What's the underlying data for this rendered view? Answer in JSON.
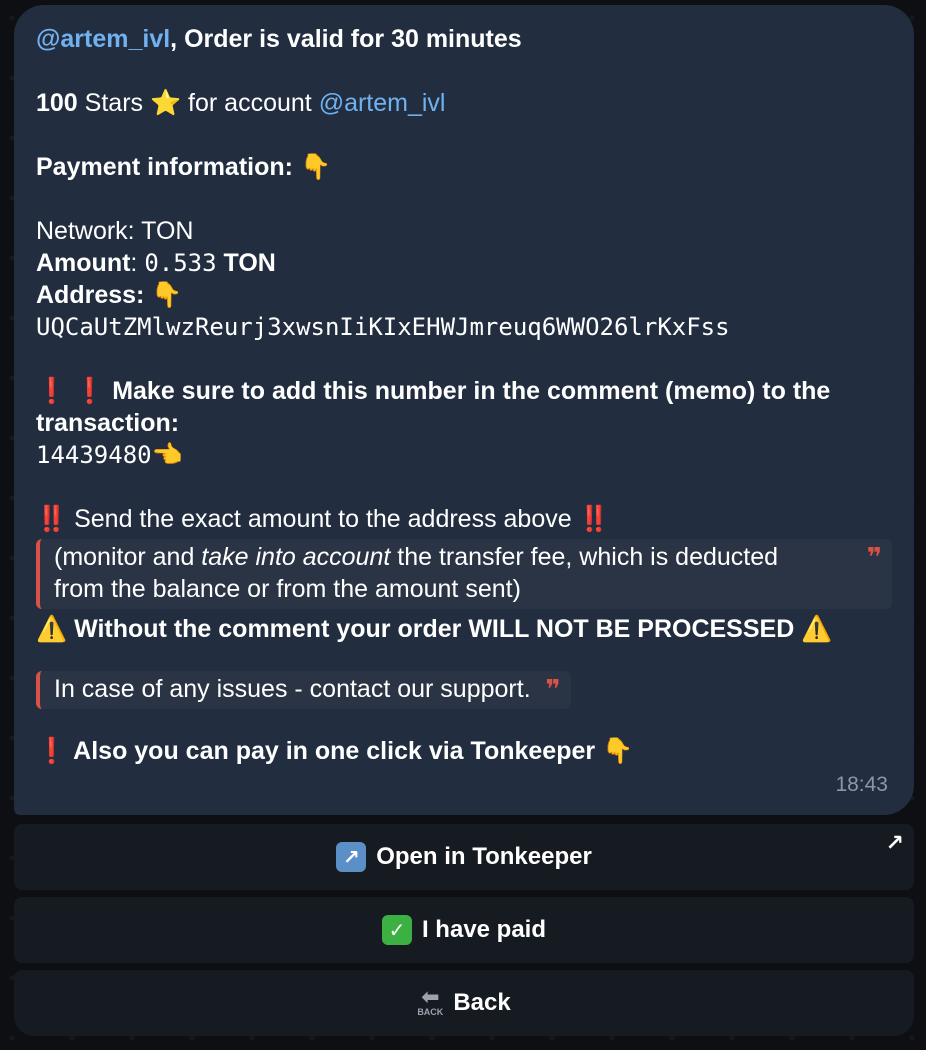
{
  "message": {
    "header_user": "@artem_ivl",
    "header_text": ", Order is valid for 30 minutes",
    "stars_amount": "100",
    "stars_word": " Stars",
    "star_emoji": "⭐",
    "for_account": " for account ",
    "account_link": "@artem_ivl",
    "payment_info_label": "Payment information",
    "payment_info_colon": ":",
    "point_down_emoji": "👇",
    "network_text": "Network: TON",
    "amount_label": "Amount",
    "amount_colon": ": ",
    "amount_value": "0.533",
    "amount_unit": " TON",
    "address_label": "Address",
    "address_colon": ":",
    "address_value": "UQCaUtZMlwzReurj3xwsnIiKIxEHWJmreuq6WWO26lrKxFss",
    "exclaim_emoji": "❗",
    "memo_warning_line1": "Make sure to add this number in the comment (memo) to the",
    "memo_warning_line2": "transaction:",
    "memo_number": "14439480",
    "point_left_emoji": "👈",
    "double_exclaim_emoji": "‼️",
    "send_exact_text": " Send the exact amount to the address above ",
    "quote1_part1": "(monitor and ",
    "quote1_italic": "take into account",
    "quote1_part2": " the transfer fee, which is deducted",
    "quote1_line2": "from the balance or from the amount sent)",
    "warning_emoji": "⚠️",
    "without_comment_text": " Without the comment your order WILL NOT BE PROCESSED ",
    "quote2_text": "In case of any issues - contact our support.",
    "quote_mark": "❞",
    "tonkeeper_text": " Also you can pay in one click via Tonkeeper",
    "time": "18:43"
  },
  "buttons": {
    "open_tonkeeper_label": "Open in Tonkeeper",
    "open_tonkeeper_icon": "↗",
    "external_link_icon": "↗",
    "paid_label": "I have paid",
    "paid_icon": "✓",
    "back_label": "Back",
    "back_icon_arrow": "⬅",
    "back_icon_text": "BACK"
  }
}
